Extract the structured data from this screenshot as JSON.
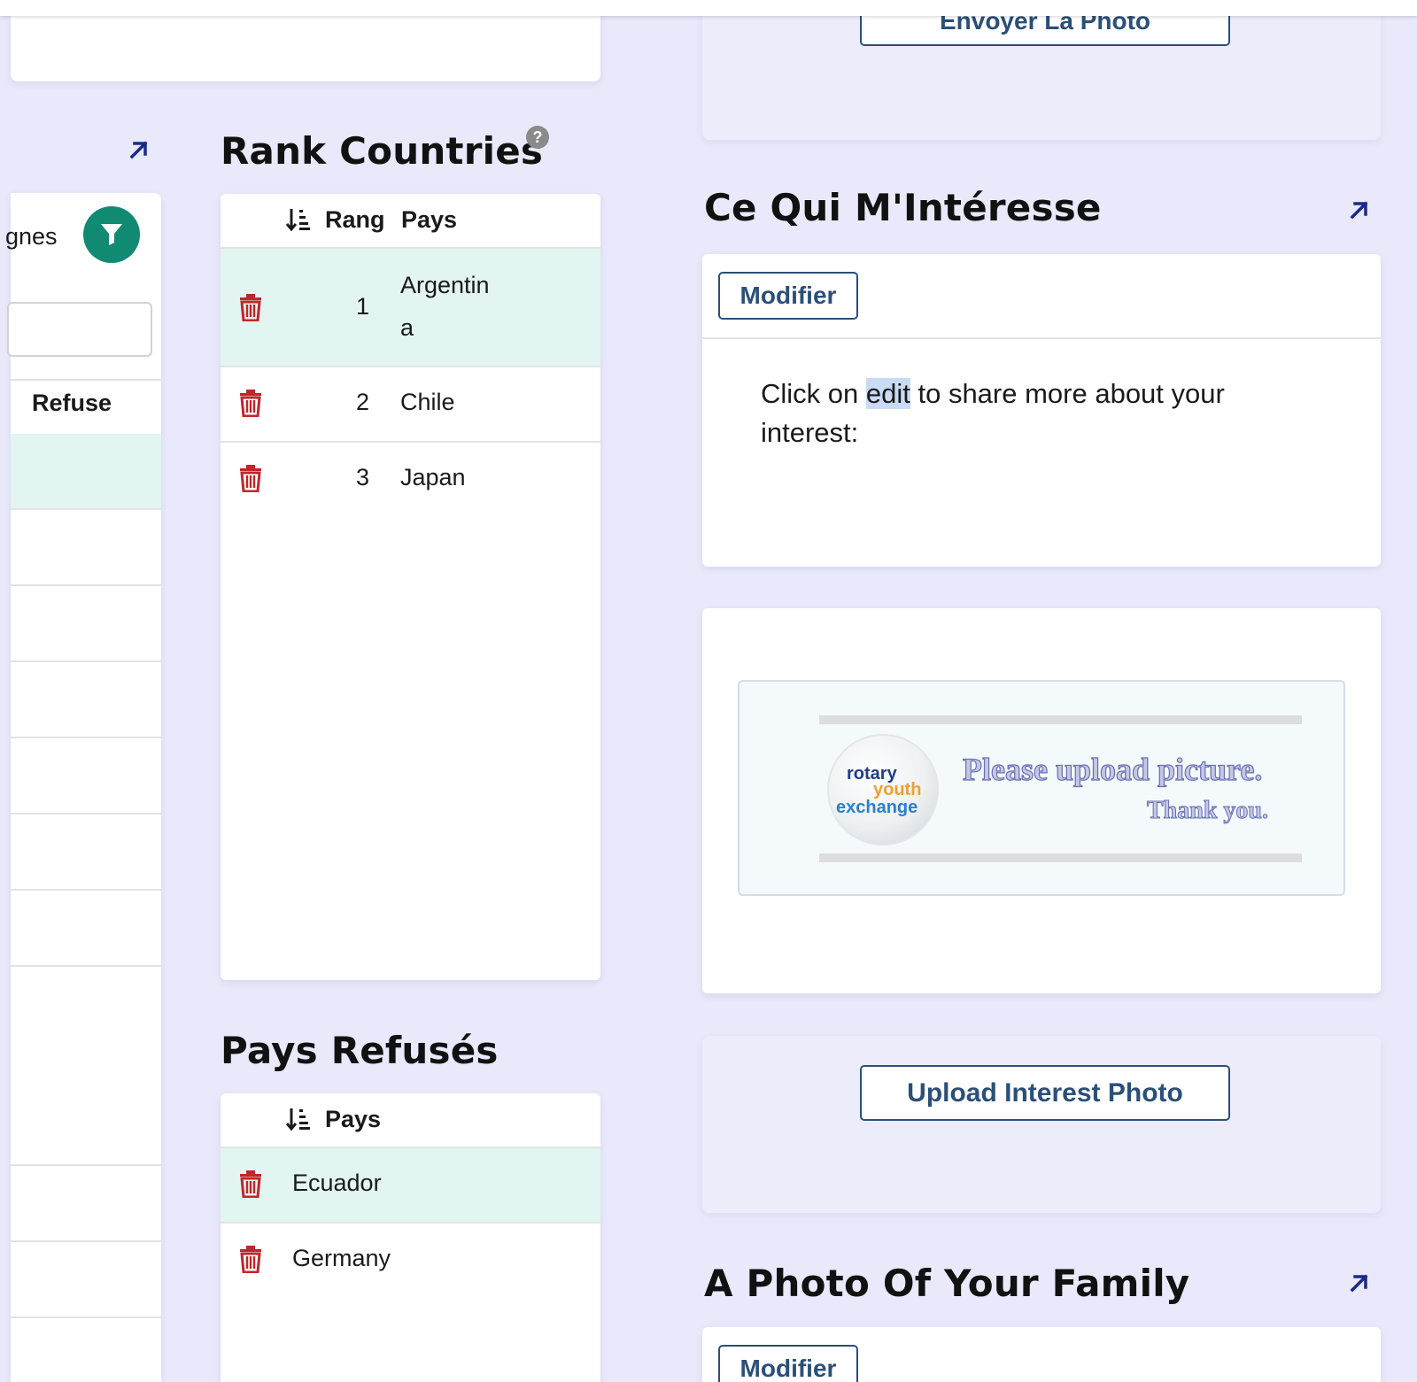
{
  "colors": {
    "background": "#e9e9fb",
    "primary": "#2b4f78",
    "accent_teal": "#108a72",
    "selected_row": "#e2f5f1",
    "trash_red": "#c0262b",
    "link_arrow": "#1a2a8a",
    "text_highlight": "#c9dbf5"
  },
  "left_panel": {
    "filter_text": "gnes",
    "column_refuse": "Refuse"
  },
  "top_card": {
    "send_photo_button": "Envoyer La Photo"
  },
  "rank": {
    "title": "Rank Countries",
    "col_rank": "Rang",
    "col_country": "Pays",
    "rows": [
      {
        "rank": "1",
        "country_line1": "Argentin",
        "country_line2": "a"
      },
      {
        "rank": "2",
        "country_line1": "Chile",
        "country_line2": ""
      },
      {
        "rank": "3",
        "country_line1": "Japan",
        "country_line2": ""
      }
    ]
  },
  "refused": {
    "title": "Pays Refusés",
    "col_country": "Pays",
    "rows": [
      "Ecuador",
      "Germany"
    ]
  },
  "interest": {
    "title": "Ce Qui M'Intéresse",
    "edit_button": "Modifier",
    "body_before": "Click on ",
    "body_highlight": "edit",
    "body_after": " to share more about your interest:",
    "placeholder_logo_line1": "rotary",
    "placeholder_logo_line2": "youth",
    "placeholder_logo_line3": "exchange",
    "placeholder_text": "Please upload picture.",
    "placeholder_subtext": "Thank you.",
    "upload_button": "Upload Interest Photo"
  },
  "family": {
    "title": "A Photo Of Your Family",
    "edit_button": "Modifier"
  }
}
